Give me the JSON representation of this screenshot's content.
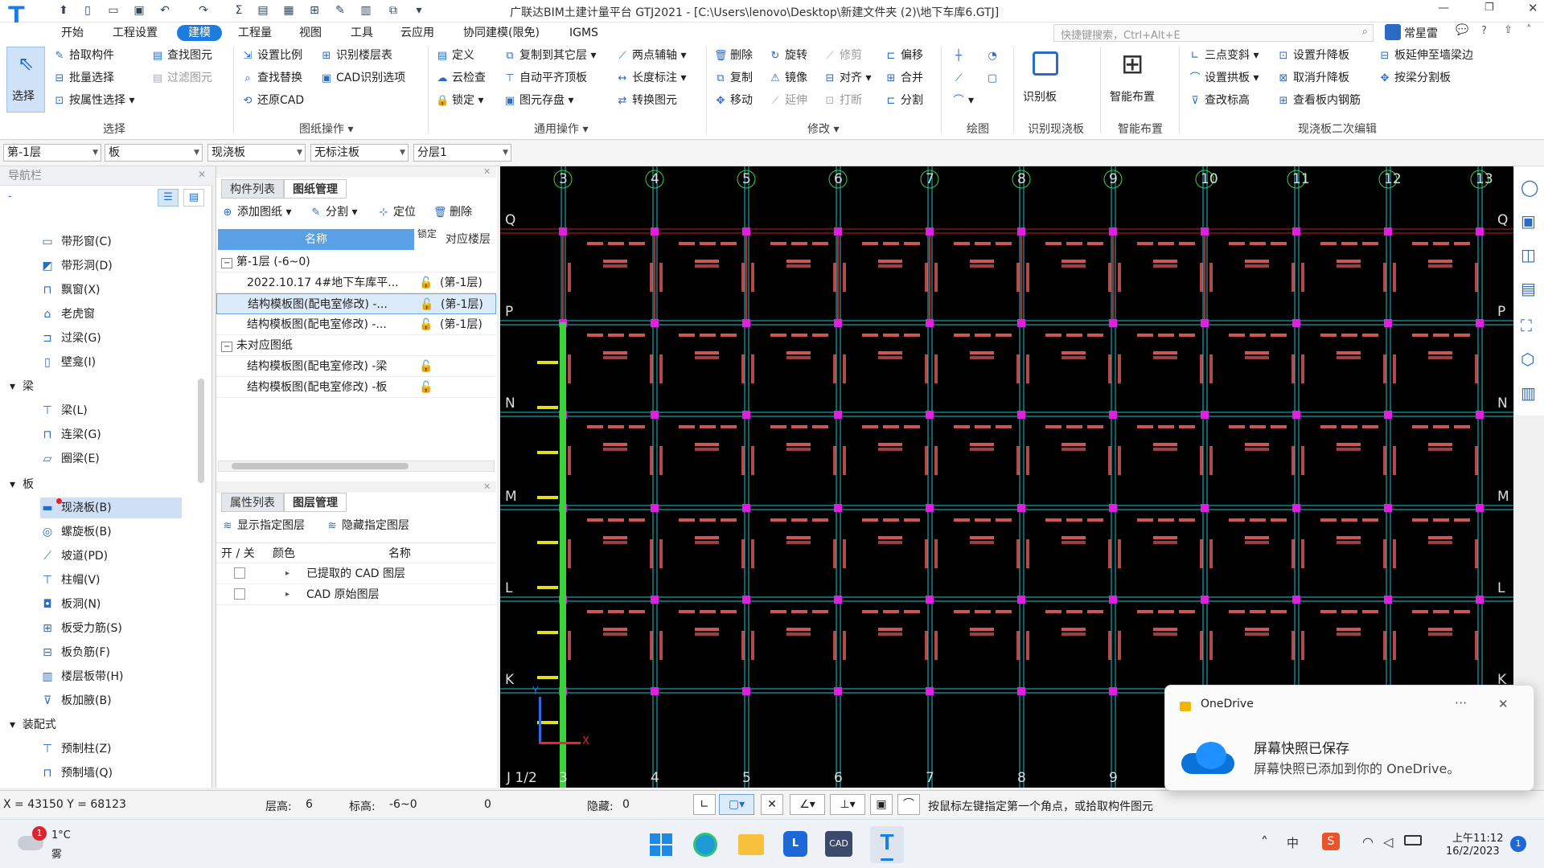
{
  "window": {
    "title": "广联达BIM土建计量平台 GTJ2021 - [C:\\Users\\lenovo\\Desktop\\新建文件夹 (2)\\地下车库6.GTJ]",
    "search_placeholder": "快捷键搜索，Ctrl+Alt+E",
    "user": "常星雷"
  },
  "menu": [
    "开始",
    "工程设置",
    "建模",
    "工程量",
    "视图",
    "工具",
    "云应用",
    "协同建模(限免)",
    "IGMS"
  ],
  "ribbon": {
    "select": {
      "big": "选择",
      "items": [
        "拾取构件",
        "批量选择",
        "按属性选择",
        "查找图元",
        "过滤图元"
      ],
      "label": "选择"
    },
    "drawing": {
      "items": [
        "设置比例",
        "识别楼层表",
        "查找替换",
        "CAD识别选项",
        "还原CAD"
      ],
      "label": "图纸操作"
    },
    "common": {
      "items": [
        "定义",
        "复制到其它层",
        "两点辅轴",
        "云检查",
        "自动平齐顶板",
        "长度标注",
        "锁定",
        "图元存盘",
        "转换图元"
      ],
      "label": "通用操作"
    },
    "modify": {
      "items": [
        "删除",
        "旋转",
        "修剪",
        "偏移",
        "复制",
        "镜像",
        "对齐",
        "合并",
        "移动",
        "延伸",
        "打断",
        "分割"
      ],
      "label": "修改"
    },
    "draw": {
      "label": "绘图"
    },
    "recognize": {
      "big": "识别板",
      "label": "识别现浇板"
    },
    "smart": {
      "big": "智能布置",
      "label": "智能布置"
    },
    "second_edit": {
      "items": [
        "三点变斜",
        "设置升降板",
        "板延伸至墙梁边",
        "设置拱板",
        "取消升降板",
        "按梁分割板",
        "查改标高",
        "查看板内钢筋"
      ],
      "label": "现浇板二次编辑"
    }
  },
  "filters": {
    "floor": "第-1层",
    "type": "板",
    "subtype": "现浇板",
    "mark": "无标注板",
    "layer": "分层1"
  },
  "nav": {
    "title": "导航栏",
    "items_top": [
      "带形窗(C)",
      "带形洞(D)",
      "飘窗(X)",
      "老虎窗",
      "过梁(G)",
      "壁龛(I)"
    ],
    "cat_beam": "梁",
    "beam_items": [
      "梁(L)",
      "连梁(G)",
      "圈梁(E)"
    ],
    "cat_slab": "板",
    "slab_items": [
      "现浇板(B)",
      "螺旋板(B)",
      "坡道(PD)",
      "柱帽(V)",
      "板洞(N)",
      "板受力筋(S)",
      "板负筋(F)",
      "楼层板带(H)",
      "板加腋(B)"
    ],
    "cat_prefab": "装配式",
    "prefab_items": [
      "预制柱(Z)",
      "预制墙(Q)"
    ]
  },
  "drawings": {
    "tabs": [
      "构件列表",
      "图纸管理"
    ],
    "toolbar": [
      "添加图纸",
      "分割",
      "定位",
      "删除"
    ],
    "headers": [
      "名称",
      "锁定",
      "对应楼层"
    ],
    "group1": "第-1层 (-6~0)",
    "rows1": [
      {
        "name": "2022.10.17 4#地下车库平...",
        "floor": "(第-1层)"
      },
      {
        "name": "结构模板图(配电室修改) -...",
        "floor": "(第-1层)"
      },
      {
        "name": "结构模板图(配电室修改) -...",
        "floor": "(第-1层)"
      }
    ],
    "group2": "未对应图纸",
    "rows2": [
      {
        "name": "结构模板图(配电室修改) -梁"
      },
      {
        "name": "结构模板图(配电室修改) -板"
      }
    ]
  },
  "layers": {
    "tabs": [
      "属性列表",
      "图层管理"
    ],
    "toolbar": [
      "显示指定图层",
      "隐藏指定图层"
    ],
    "headers": [
      "开 / 关",
      "颜色",
      "名称"
    ],
    "rows": [
      "已提取的 CAD 图层",
      "CAD 原始图层"
    ]
  },
  "canvas": {
    "col_labels": [
      "3",
      "4",
      "5",
      "6",
      "7",
      "8",
      "9",
      "10",
      "11",
      "12",
      "13"
    ],
    "row_labels": [
      "Q",
      "P",
      "N",
      "M",
      "L",
      "K"
    ],
    "bottom_labels": [
      "J 1/2",
      "3",
      "4",
      "5",
      "6",
      "7",
      "8",
      "9"
    ],
    "colors": {
      "bg": "#000000",
      "grid": "#19c8d0",
      "beam": "#c81e1e",
      "node": "#e020e0",
      "text": "#ff6a6a",
      "axis": "#3cd23c"
    }
  },
  "status": {
    "coords": "X = 43150 Y = 68123",
    "floor_height_label": "层高:",
    "floor_height": "6",
    "elev_label": "标高:",
    "elev": "-6~0",
    "zero": "0",
    "hidden_label": "隐藏:",
    "hidden": "0",
    "hint": "按鼠标左键指定第一个角点，或拾取构件图元"
  },
  "toast": {
    "app": "OneDrive",
    "title": "屏幕快照已保存",
    "body": "屏幕快照已添加到你的 OneDrive。"
  },
  "taskbar": {
    "weather_temp": "1°C",
    "weather_desc": "雾",
    "weather_badge": "1",
    "time": "上午11:12",
    "date": "16/2/2023",
    "notif": "1"
  }
}
